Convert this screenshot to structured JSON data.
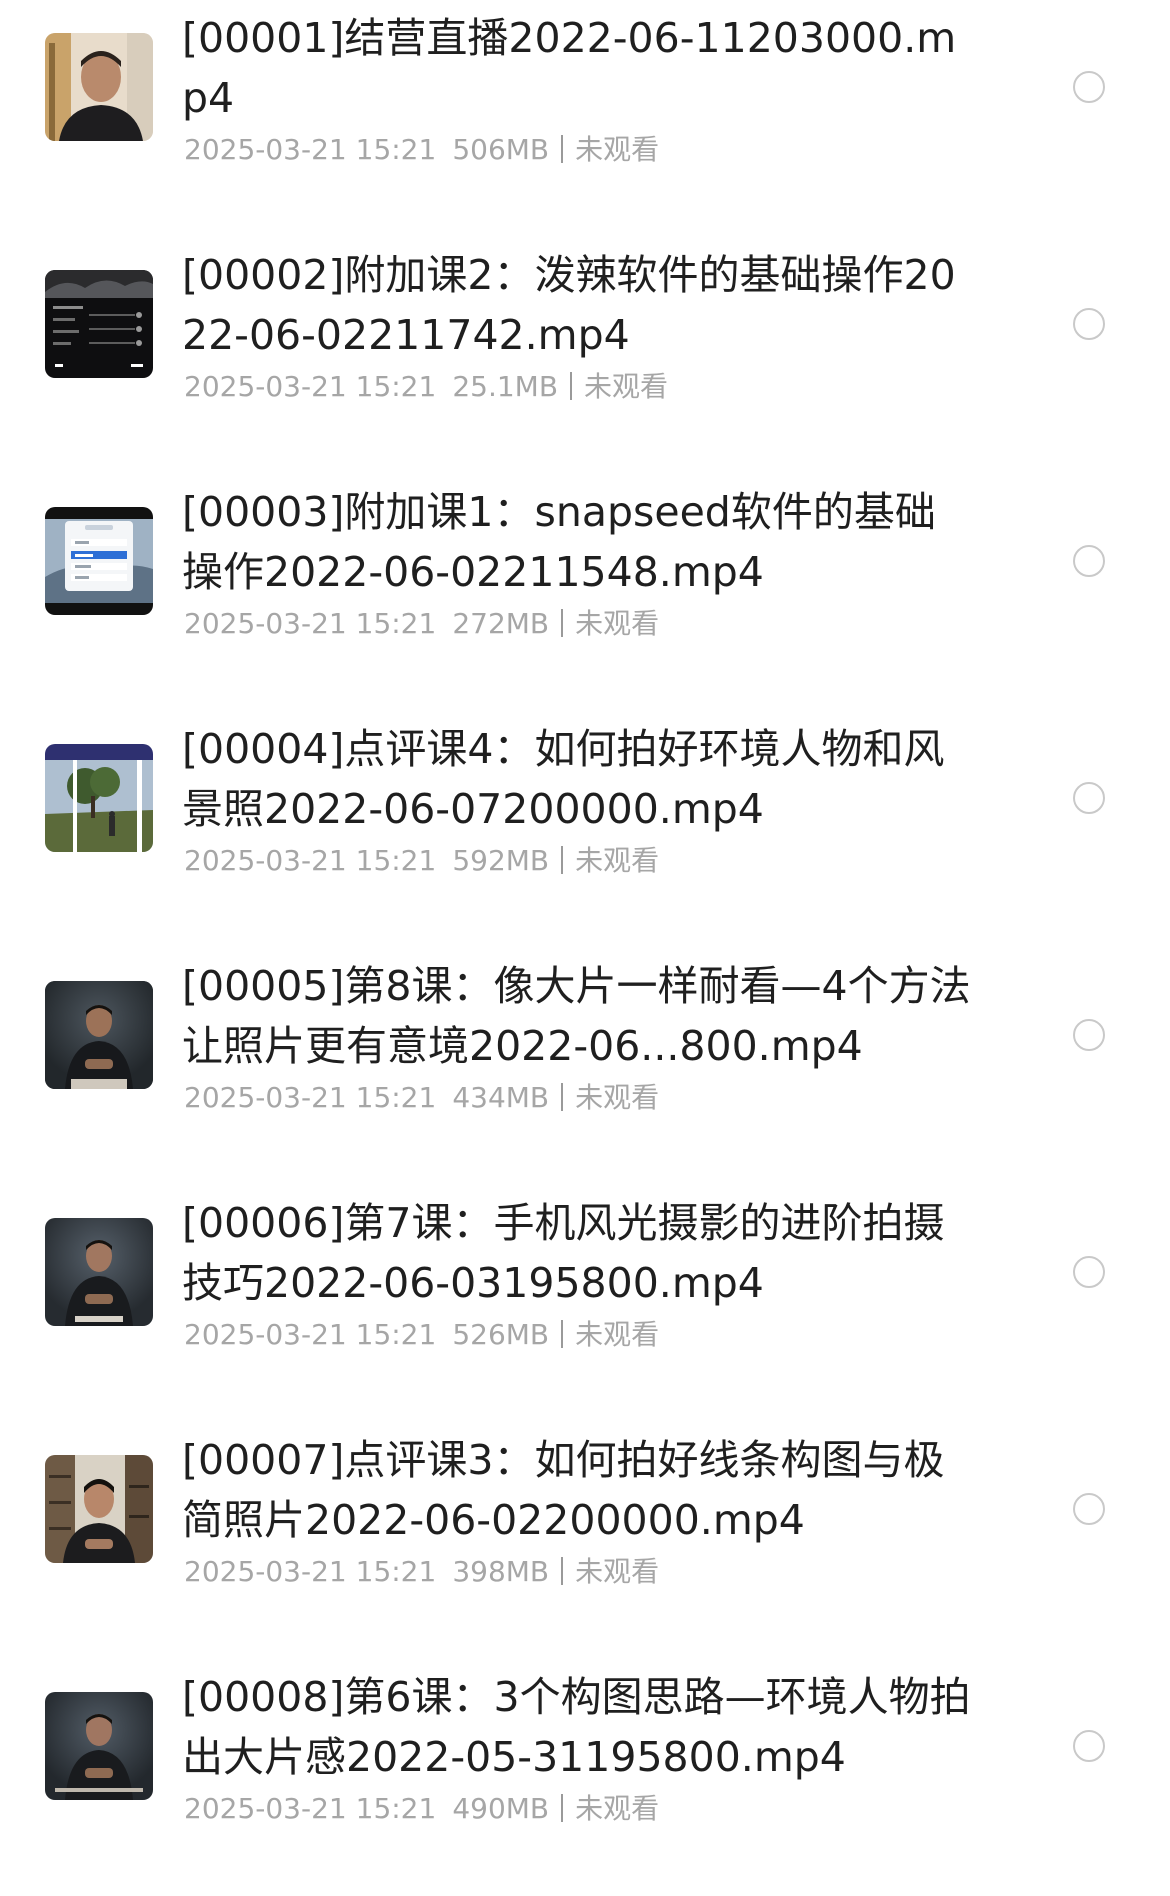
{
  "files": [
    {
      "title": "[00001]结营直播2022-06-11203000.mp4",
      "date": "2025-03-21 15:21",
      "size": "506MB",
      "status": "未观看",
      "thumb": "portrait-warm"
    },
    {
      "title": "[00002]附加课2：泼辣软件的基础操作2022-06-02211742.mp4",
      "date": "2025-03-21 15:21",
      "size": "25.1MB",
      "status": "未观看",
      "thumb": "app-dark-screen"
    },
    {
      "title": "[00003]附加课1：snapseed软件的基础操作2022-06-02211548.mp4",
      "date": "2025-03-21 15:21",
      "size": "272MB",
      "status": "未观看",
      "thumb": "app-menu-screen"
    },
    {
      "title": "[00004]点评课4：如何拍好环境人物和风景照2022-06-07200000.mp4",
      "date": "2025-03-21 15:21",
      "size": "592MB",
      "status": "未观看",
      "thumb": "landscape-photo"
    },
    {
      "title": "[00005]第8课：像大片一样耐看—4个方法让照片更有意境2022-06...800.mp4",
      "date": "2025-03-21 15:21",
      "size": "434MB",
      "status": "未观看",
      "thumb": "presenter-dark"
    },
    {
      "title": "[00006]第7课：手机风光摄影的进阶拍摄技巧2022-06-03195800.mp4",
      "date": "2025-03-21 15:21",
      "size": "526MB",
      "status": "未观看",
      "thumb": "presenter-dark"
    },
    {
      "title": "[00007]点评课3：如何拍好线条构图与极简照片2022-06-02200000.mp4",
      "date": "2025-03-21 15:21",
      "size": "398MB",
      "status": "未观看",
      "thumb": "presenter-shelf"
    },
    {
      "title": "[00008]第6课：3个构图思路—环境人物拍出大片感2022-05-31195800.mp4",
      "date": "2025-03-21 15:21",
      "size": "490MB",
      "status": "未观看",
      "thumb": "presenter-dark"
    }
  ]
}
